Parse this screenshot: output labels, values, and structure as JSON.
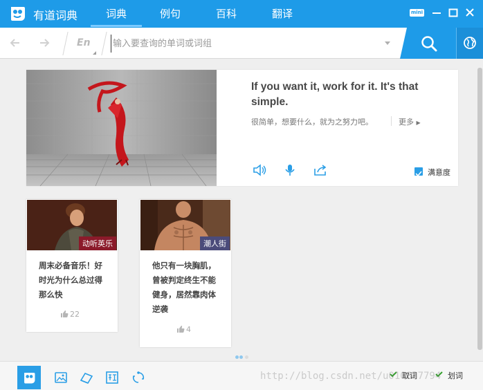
{
  "app": {
    "title": "有道词典"
  },
  "nav": {
    "tabs": [
      {
        "label": "词典",
        "active": true
      },
      {
        "label": "例句",
        "active": false
      },
      {
        "label": "百科",
        "active": false
      },
      {
        "label": "翻译",
        "active": false
      }
    ]
  },
  "window": {
    "mini_label": "mini"
  },
  "search": {
    "lang": "En",
    "placeholder": "输入要查询的单词或词组",
    "value": ""
  },
  "daily": {
    "quote_en": "If you want it, work for it. It's that simple.",
    "quote_zh": "很简单，想要什么，就为之努力吧。",
    "more": "更多",
    "satisfy": "满意度"
  },
  "feed": [
    {
      "tag": "动听英乐",
      "tag_color": "#8b1a2a",
      "text": "周末必备音乐！好时光为什么总过得那么快",
      "likes": "22"
    },
    {
      "tag": "潮人街",
      "tag_color": "#4b4b7a",
      "text": "他只有一块胸肌，曾被判定终生不能健身，居然靠肉体逆袭",
      "likes": "4"
    }
  ],
  "bottom": {
    "option1": "取词",
    "option2": "划词"
  },
  "watermark": "http://blog.csdn.net/u010837794",
  "colors": {
    "brand": "#1e9be8",
    "check": "#33a02c"
  }
}
